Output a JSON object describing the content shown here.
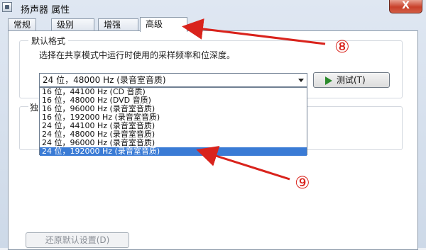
{
  "window": {
    "title": "扬声器 属性",
    "close_label": "X"
  },
  "tabs": [
    {
      "label": "常规"
    },
    {
      "label": "级别"
    },
    {
      "label": "增强"
    },
    {
      "label": "高级",
      "active": true
    }
  ],
  "advanced": {
    "group_label": "默认格式",
    "description": "选择在共享模式中运行时使用的采样频率和位深度。",
    "selected_value": "24 位，48000 Hz (录音室音质)",
    "test_button": "测试(T)",
    "exclusive_group_label": "独",
    "dropdown_options": [
      "16 位，44100 Hz (CD 音质)",
      "16 位，48000 Hz (DVD 音质)",
      "16 位，96000 Hz (录音室音质)",
      "16 位，192000 Hz (录音室音质)",
      "24 位，44100 Hz (录音室音质)",
      "24 位，48000 Hz (录音室音质)",
      "24 位，96000 Hz (录音室音质)",
      "24 位，192000 Hz (录音室音质)"
    ],
    "highlighted_option_index": 7,
    "reset_button": "还原默认设置(D)"
  },
  "annotations": {
    "callout_8": "⑧",
    "callout_9": "⑨",
    "arrow_color": "#d9231c"
  }
}
